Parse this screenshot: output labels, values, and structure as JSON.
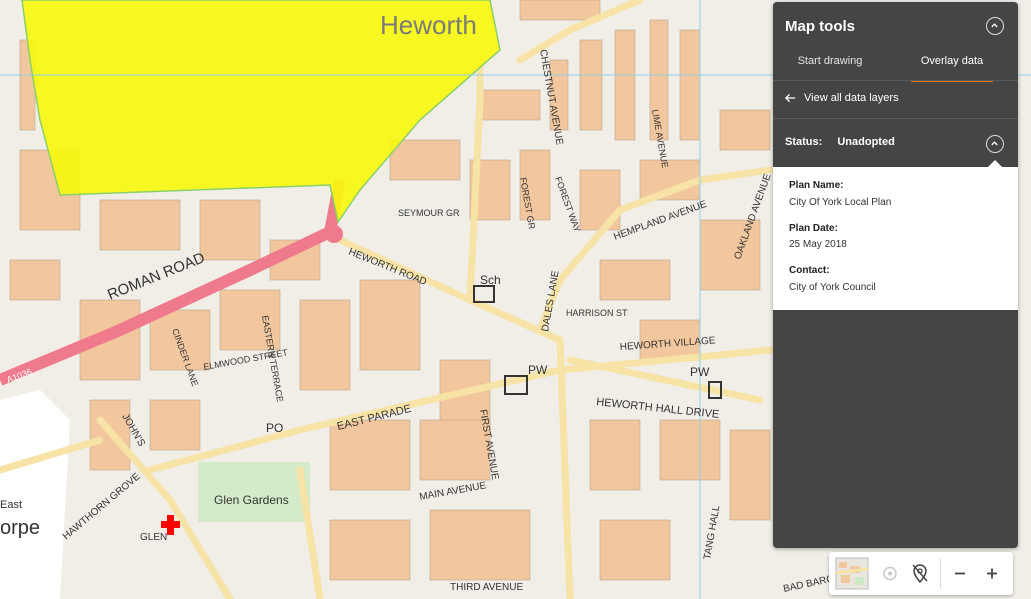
{
  "map": {
    "labels": {
      "heworth": "Heworth",
      "roman_road": "ROMAN ROAD",
      "heworth_road": "HEWORTH ROAD",
      "east_parade": "EAST PARADE",
      "heworth_hall_drive": "HEWORTH HALL DRIVE",
      "heworth_village": "HEWORTH VILLAGE",
      "hempland_avenue": "HEMPLAND AVENUE",
      "glen_gardens": "Glen Gardens",
      "main_avenue": "MAIN AVENUE",
      "third_avenue": "THIRD AVENUE",
      "sch": "Sch",
      "pw1": "PW",
      "pw2": "PW",
      "po": "PO",
      "a1036": "A1036",
      "dales_lane": "DALES LANE",
      "harrison_st": "HARRISON ST",
      "chestnut_avenue": "CHESTNUT AVENUE",
      "forest_way": "FOREST WAY",
      "forest_gr": "FOREST GR",
      "seymour_gr": "SEYMOUR GR",
      "oakland_avenue": "OAKLAND AVENUE",
      "first_avenue": "FIRST AVENUE",
      "hawthorn_grove": "HAWTHORN GROVE",
      "tang_hall": "TANG HALL",
      "east": "East",
      "orpe": "orpe",
      "glen": "GLEN",
      "johns": "JOHN'S",
      "cinder_lane": "CINDER LANE",
      "eastern_terrace": "EASTERN TERRACE",
      "elmwood_street": "ELMWOOD STREET",
      "lime_avenue": "LIME AVENUE",
      "bad_bargain": "BAD BARGAIN"
    },
    "colors": {
      "background": "#f1eee8",
      "buildings": "#f2c79e",
      "overlay": "#f7f710",
      "a_road": "#ef7a8c",
      "minor_road": "#f7e3a6",
      "green": "#cfe8c5",
      "marker": "#ff0000"
    }
  },
  "panel": {
    "title": "Map tools",
    "tabs": [
      {
        "label": "Start drawing",
        "active": false
      },
      {
        "label": "Overlay data",
        "active": true
      }
    ],
    "back_link": "View all data layers",
    "status_label": "Status:",
    "status_value": "Unadopted",
    "details": [
      {
        "label": "Plan Name:",
        "value": "City Of York Local Plan"
      },
      {
        "label": "Plan Date:",
        "value": "25 May 2018"
      },
      {
        "label": "Contact:",
        "value": "City of York Council"
      }
    ],
    "colors": {
      "background": "#454545",
      "accent": "#e8751a"
    }
  },
  "toolbar": {
    "buttons": [
      "map-thumbnail",
      "locate-icon",
      "pin-off-icon",
      "minus-icon",
      "plus-icon"
    ]
  }
}
